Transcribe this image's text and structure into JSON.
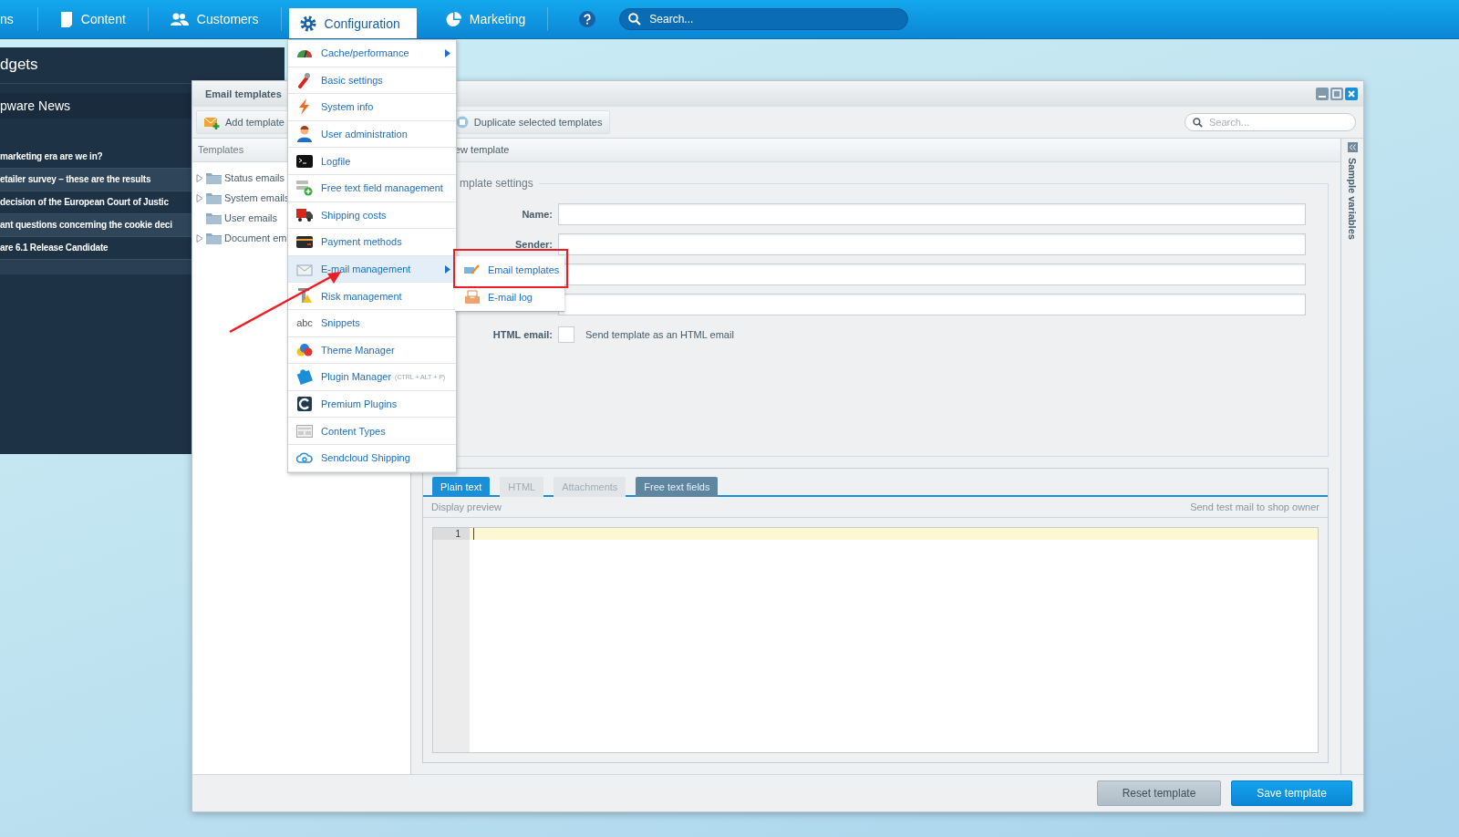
{
  "top_nav": {
    "items": [
      {
        "label": "ns",
        "selected": false
      },
      {
        "label": "Content",
        "selected": false
      },
      {
        "label": "Customers",
        "selected": false
      },
      {
        "label": "Configuration",
        "selected": true
      },
      {
        "label": "Marketing",
        "selected": false
      }
    ],
    "search": {
      "placeholder": "Search..."
    }
  },
  "widgets": {
    "title": "dgets",
    "news": {
      "title": "pware News",
      "items": [
        "marketing era are we in?",
        "etailer survey – these are the results",
        "decision of the European Court of Justic",
        "ant questions concerning the cookie deci",
        "are 6.1 Release Candidate"
      ]
    }
  },
  "window": {
    "title": "Email templates",
    "toolbar": {
      "buttons": [
        "Add template",
        "Duplicate selected templates"
      ],
      "search": {
        "placeholder": "Search..."
      }
    },
    "tree": {
      "header": "Templates",
      "items": [
        {
          "label": "Status emails",
          "expandable": true
        },
        {
          "label": "System emails",
          "expandable": true
        },
        {
          "label": "User emails",
          "expandable": false
        },
        {
          "label": "Document em",
          "expandable": true
        }
      ]
    },
    "editor_header": "ew template",
    "fieldset": "mplate settings",
    "form": {
      "fields": [
        {
          "kind": "text",
          "label": "Name:"
        },
        {
          "kind": "text",
          "label": "Sender:"
        },
        {
          "kind": "text"
        },
        {
          "kind": "text"
        },
        {
          "kind": "checkbox",
          "label": "HTML email:",
          "checked": false,
          "text": "Send template as an HTML email"
        }
      ]
    },
    "sidebar": {
      "label": "Sample variables"
    },
    "tabs": [
      {
        "label": "Plain text",
        "selected": true,
        "disabled": false
      },
      {
        "label": "HTML",
        "selected": false,
        "disabled": true
      },
      {
        "label": "Attachments",
        "selected": false,
        "disabled": true
      },
      {
        "label": "Free text fields",
        "selected": false,
        "disabled": false
      }
    ],
    "preview_bar": {
      "left": "Display preview",
      "right": "Send test mail to shop owner"
    },
    "editor": {
      "line_numbers": [
        "1"
      ]
    },
    "footer": {
      "buttons": [
        {
          "label": "Reset template",
          "kind": "secondary"
        },
        {
          "label": "Save template",
          "kind": "primary"
        }
      ]
    }
  },
  "menu": {
    "items": [
      {
        "label": "Cache/performance",
        "has_submenu": true,
        "selected": false
      },
      {
        "label": "Basic settings",
        "has_submenu": false,
        "selected": false
      },
      {
        "label": "System info",
        "has_submenu": false,
        "selected": false
      },
      {
        "label": "User administration",
        "has_submenu": false,
        "selected": false
      },
      {
        "label": "Logfile",
        "has_submenu": false,
        "selected": false
      },
      {
        "label": "Free text field management",
        "has_submenu": false,
        "selected": false
      },
      {
        "label": "Shipping costs",
        "has_submenu": false,
        "selected": false
      },
      {
        "label": "Payment methods",
        "has_submenu": false,
        "selected": false
      },
      {
        "label": "E-mail management",
        "has_submenu": true,
        "selected": true
      },
      {
        "label": "Risk management",
        "has_submenu": false,
        "selected": false
      },
      {
        "label": "Snippets",
        "icon_text": "abc",
        "has_submenu": false,
        "selected": false
      },
      {
        "label": "Theme Manager",
        "has_submenu": false,
        "selected": false
      },
      {
        "label": "Plugin Manager",
        "shortcut": "(CTRL + ALT + P)",
        "has_submenu": false,
        "selected": false
      },
      {
        "label": "Premium Plugins",
        "has_submenu": false,
        "selected": false
      },
      {
        "label": "Content Types",
        "has_submenu": false,
        "selected": false
      },
      {
        "label": "Sendcloud Shipping",
        "has_submenu": false,
        "selected": false
      }
    ]
  },
  "submenu": {
    "items": [
      {
        "label": "Email templates"
      },
      {
        "label": "E-mail log"
      }
    ]
  }
}
